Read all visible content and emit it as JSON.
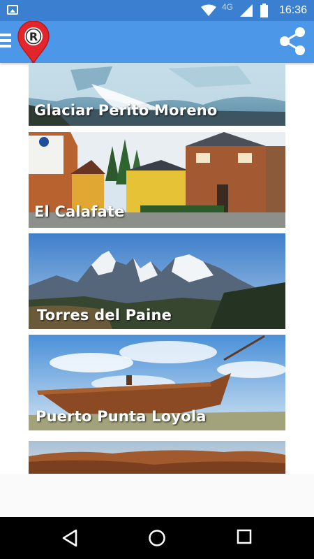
{
  "status_bar": {
    "time": "16:36",
    "network": "4G",
    "icons": [
      "image-icon",
      "wifi-icon",
      "signal-icon",
      "battery-icon"
    ]
  },
  "app_bar": {
    "logo_letter": "R",
    "menu_icon": "hamburger-icon",
    "share_icon": "share-icon",
    "color": "#4d97e8"
  },
  "destinations": [
    {
      "name": "Glaciar Perito Moreno"
    },
    {
      "name": "El Calafate"
    },
    {
      "name": "Torres del Paine"
    },
    {
      "name": "Puerto Punta Loyola"
    },
    {
      "name": ""
    }
  ],
  "nav_bar": {
    "icons": [
      "back-icon",
      "home-icon",
      "recents-icon"
    ]
  }
}
